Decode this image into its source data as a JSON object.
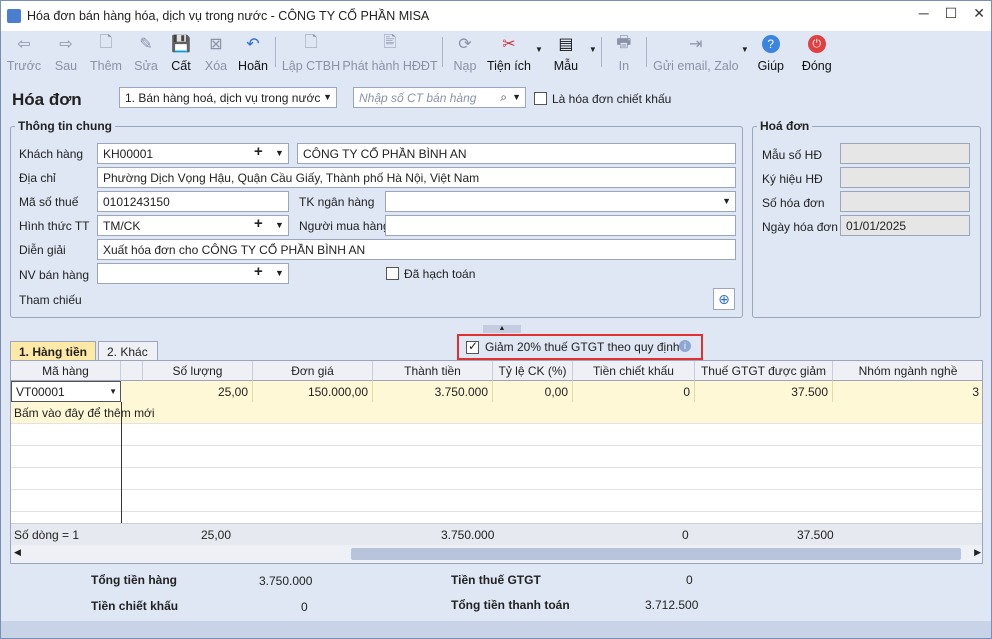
{
  "window": {
    "title": "Hóa đơn bán hàng hóa, dịch vụ trong nước - CÔNG TY CỔ PHẦN MISA"
  },
  "toolbar": {
    "items": [
      {
        "label": "Trước",
        "icon": "arrow-left-icon"
      },
      {
        "label": "Sau",
        "icon": "arrow-right-icon"
      },
      {
        "label": "Thêm",
        "icon": "add-doc-icon"
      },
      {
        "label": "Sửa",
        "icon": "edit-doc-icon"
      },
      {
        "label": "Cất",
        "icon": "save-icon"
      },
      {
        "label": "Xóa",
        "icon": "delete-doc-icon"
      },
      {
        "label": "Hoãn",
        "icon": "undo-icon"
      },
      {
        "label": "Lập CTBH",
        "icon": "doc-icon"
      },
      {
        "label": "Phát hành HĐĐT",
        "icon": "publish-icon"
      },
      {
        "label": "Nạp",
        "icon": "refresh-icon"
      },
      {
        "label": "Tiện ích",
        "icon": "tools-icon"
      },
      {
        "label": "Mẫu",
        "icon": "template-icon"
      },
      {
        "label": "In",
        "icon": "printer-icon"
      },
      {
        "label": "Gửi email, Zalo",
        "icon": "send-icon"
      },
      {
        "label": "Giúp",
        "icon": "help-icon"
      },
      {
        "label": "Đóng",
        "icon": "power-icon"
      }
    ]
  },
  "header": {
    "title": "Hóa đơn",
    "invoice_type": "1. Bán hàng hoá, dịch vụ trong nước",
    "search_placeholder": "Nhập số CT bán hàng",
    "discount_invoice_label": "Là hóa đơn chiết khấu"
  },
  "general": {
    "group_title": "Thông tin chung",
    "customer_label": "Khách hàng",
    "customer_code": "KH00001",
    "customer_name": "CÔNG TY CỔ PHẦN BÌNH AN",
    "address_label": "Địa chỉ",
    "address": "Phường Dịch Vọng Hậu, Quận Cầu Giấy, Thành phố Hà Nội, Việt Nam",
    "tax_code_label": "Mã số thuế",
    "tax_code": "0101243150",
    "bank_label": "TK ngân hàng",
    "bank": "",
    "payment_label": "Hình thức TT",
    "payment": "TM/CK",
    "buyer_label": "Người mua hàng",
    "buyer": "",
    "desc_label": "Diễn giải",
    "desc": "Xuất hóa đơn cho CÔNG TY CỔ PHẦN BÌNH AN",
    "staff_label": "NV bán hàng",
    "staff": "",
    "posted_label": "Đã hạch toán",
    "ref_label": "Tham chiếu"
  },
  "invoice": {
    "group_title": "Hoá đơn",
    "form_label": "Mẫu số HĐ",
    "form": "",
    "symbol_label": "Ký hiệu HĐ",
    "symbol": "",
    "number_label": "Số hóa đơn",
    "number": "",
    "date_label": "Ngày hóa đơn",
    "date": "01/01/2025"
  },
  "tabs": [
    {
      "label": "1. Hàng tiền"
    },
    {
      "label": "2. Khác"
    }
  ],
  "reduction": {
    "label": "Giảm 20% thuế GTGT theo quy định",
    "checked": true
  },
  "grid": {
    "columns": [
      "Mã hàng",
      "Số lượng",
      "Đơn giá",
      "Thành tiền",
      "Tỷ lệ CK (%)",
      "Tiền chiết khấu",
      "Thuế GTGT được giảm",
      "Nhóm ngành nghề"
    ],
    "rows": [
      {
        "code": "VT00001",
        "qty": "25,00",
        "price": "150.000,00",
        "amount": "3.750.000",
        "ck_rate": "0,00",
        "ck_amount": "0",
        "vat_reduced": "37.500",
        "group": "3"
      }
    ],
    "add_hint": "Bấm vào đây để thêm mới",
    "footer": {
      "count": "Số dòng = 1",
      "qty": "25,00",
      "amount": "3.750.000",
      "ck_amount": "0",
      "vat_reduced": "37.500"
    }
  },
  "totals": {
    "goods_label": "Tổng tiền hàng",
    "goods": "3.750.000",
    "discount_label": "Tiền chiết khấu",
    "discount": "0",
    "vat_label": "Tiền thuế GTGT",
    "vat": "0",
    "pay_label": "Tổng tiền thanh toán",
    "pay": "3.712.500"
  },
  "colors": {
    "accent": "#2c6fd1",
    "highlight_border": "#e03030",
    "row_highlight": "#fff8d6"
  }
}
